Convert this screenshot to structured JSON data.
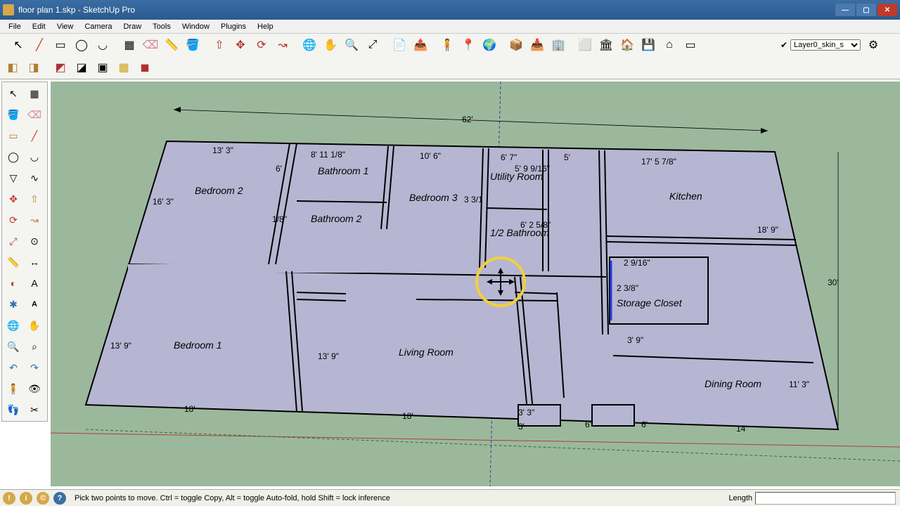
{
  "title": "floor plan 1.skp - SketchUp Pro",
  "menu": [
    "File",
    "Edit",
    "View",
    "Camera",
    "Draw",
    "Tools",
    "Window",
    "Plugins",
    "Help"
  ],
  "layer": {
    "value": "Layer0_skin_s"
  },
  "status": {
    "msg": "Pick two points to move.  Ctrl = toggle Copy, Alt = toggle Auto-fold, hold Shift = lock inference",
    "len_label": "Length",
    "len_value": ""
  },
  "rooms": {
    "bedroom1": "Bedroom 1",
    "bedroom2": "Bedroom 2",
    "bedroom3": "Bedroom 3",
    "bathroom1": "Bathroom 1",
    "bathroom2": "Bathroom 2",
    "half_bath": "1/2 Bathroom",
    "utility": "Utility Room",
    "kitchen": "Kitchen",
    "storage": "Storage Closet",
    "living": "Living Room",
    "dining": "Dining Room"
  },
  "dims": {
    "overall_w": "62'",
    "overall_h": "30'",
    "d_13_3": "13' 3\"",
    "d_8_11": "8' 11 1/8\"",
    "d_10_6": "10' 6\"",
    "d_6": "6'",
    "d_6_7": "6' 7\"",
    "d_5_9": "5' 9 9/16\"",
    "d_17_5": "17' 5 7/8\"",
    "d_16_3": "16' 3\"",
    "d_18_9": "18' 9\"",
    "d_18a": "18'",
    "d_18b": "18'",
    "d_3_3": "3' 3\"",
    "d_13_9a": "13' 9\"",
    "d_13_9b": "13' 9\"",
    "d_2_9": "2 9/16\"",
    "d_2_3_8": "2 3/8\"",
    "d_3_9": "3' 9\"",
    "d_11_3": "11' 3\"",
    "d_14": "14'",
    "d_6_2": "6' 2 5/8\"",
    "d_1_8a": "1/8\"",
    "d_6_b": "6'",
    "d_6_c": "6'",
    "d_3_b": "3'",
    "d_5": "5'",
    "d_3_1": "3 3/1"
  }
}
